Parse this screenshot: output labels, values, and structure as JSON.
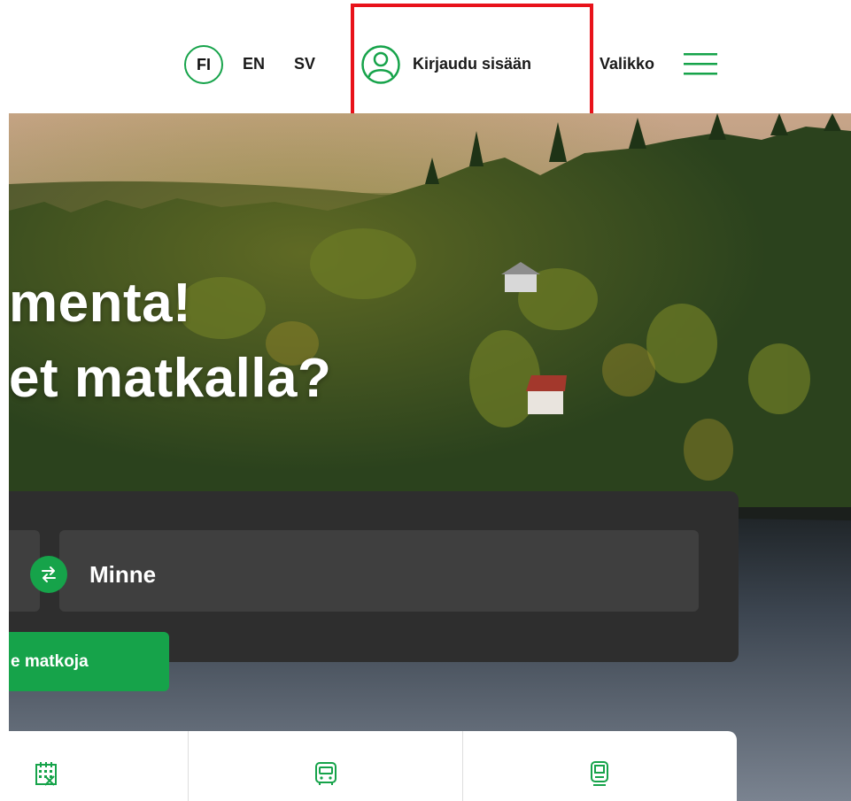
{
  "header": {
    "languages": {
      "active": "FI",
      "options": [
        "EN",
        "SV"
      ]
    },
    "login_label": "Kirjaudu sisään",
    "menu_label": "Valikko",
    "highlight_color": "#e8121a",
    "accent_color": "#16a34a"
  },
  "hero": {
    "headline_line1": "menta!",
    "headline_line2": "et matkalla?"
  },
  "search": {
    "to_label": "Minne",
    "swap_icon": "swap-arrows-icon",
    "submit_label": "e matkoja"
  },
  "quick_links": [
    {
      "icon": "calendar-icon"
    },
    {
      "icon": "bus-icon"
    },
    {
      "icon": "train-icon"
    }
  ]
}
